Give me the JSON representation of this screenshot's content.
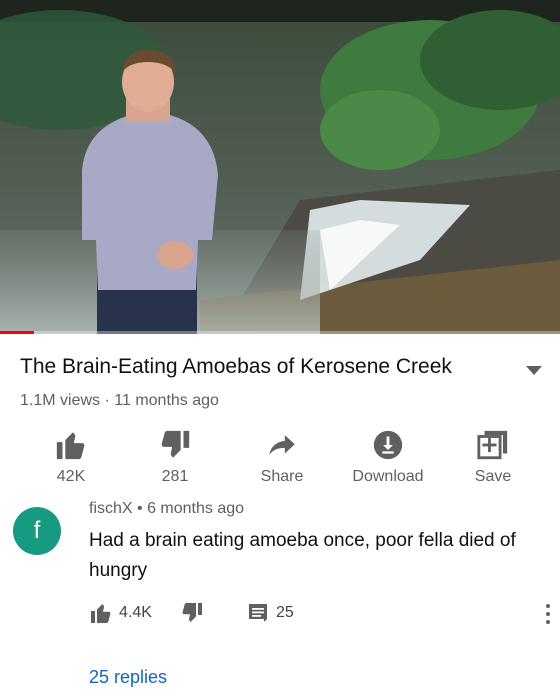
{
  "video": {
    "title": "The Brain-Eating Amoebas of Kerosene Creek",
    "views": "1.1M views",
    "age": "11 months ago",
    "progress_fraction": 0.06,
    "progress_color": "#ff0000"
  },
  "actions": [
    {
      "icon": "thumbs-up-icon",
      "label": "42K"
    },
    {
      "icon": "thumbs-down-icon",
      "label": "281"
    },
    {
      "icon": "share-arrow-icon",
      "label": "Share"
    },
    {
      "icon": "download-icon",
      "label": "Download"
    },
    {
      "icon": "add-to-playlist-icon",
      "label": "Save"
    }
  ],
  "comment": {
    "avatar_letter": "f",
    "avatar_color": "#169b82",
    "author": "fischX",
    "age": "6 months ago",
    "text": "Had a brain eating amoeba once, poor fella died of hungry",
    "likes": "4.4K",
    "reply_count": "25",
    "replies_link": "25 replies",
    "link_color": "#1565c0"
  }
}
